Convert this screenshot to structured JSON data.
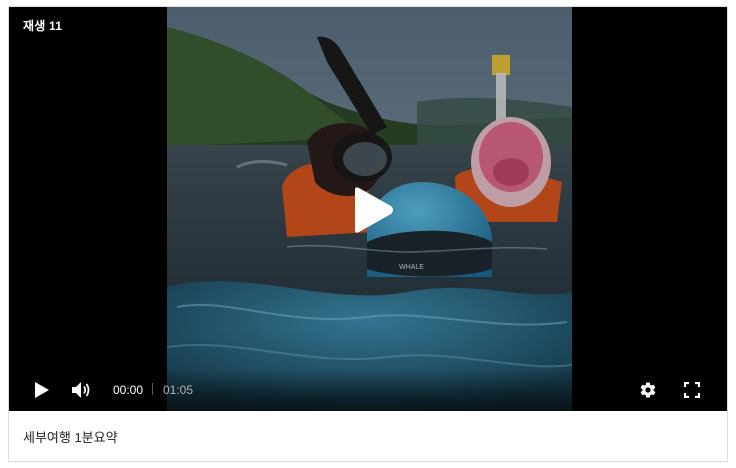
{
  "player": {
    "play_count": "재생 11",
    "time_current": "00:00",
    "time_total": "01:05",
    "icons": {
      "big_play": "play-icon",
      "play": "play-icon",
      "volume": "volume-icon",
      "settings": "gear-icon",
      "fullscreen": "fullscreen-icon"
    }
  },
  "caption": {
    "title": "세부여행 1분요약"
  },
  "colors": {
    "player_bg": "#000000",
    "control_text": "#ffffff",
    "time_total_text": "#b5b5b5",
    "caption_text": "#222222"
  }
}
